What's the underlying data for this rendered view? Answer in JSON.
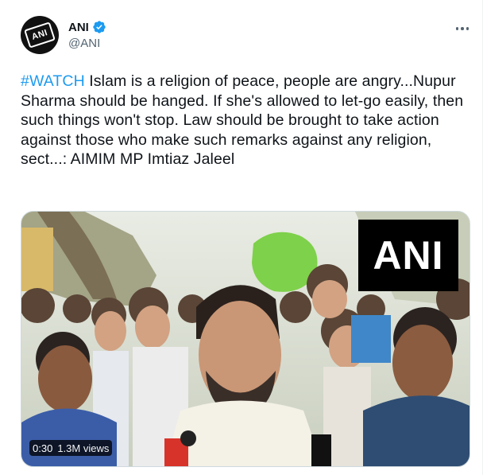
{
  "author": {
    "display_name": "ANI",
    "handle": "@ANI",
    "avatar_icon": "ani-logo-avatar",
    "avatar_text": "ANI",
    "verified_icon": "verified-badge-icon",
    "verified_color": "#1d9bf0"
  },
  "tweet": {
    "hashtag": "#WATCH",
    "text": " Islam is a religion of peace, people are angry...Nupur Sharma should be hanged. If she's allowed to let-go easily, then such things won't stop. Law should be brought to take action against those who make such remarks against any religion, sect...: AIMIM MP Imtiaz Jaleel",
    "hashtag_color": "#1d9bf0"
  },
  "media": {
    "type": "video",
    "watermark": "ANI",
    "duration": "0:30",
    "views": "1.3M views"
  },
  "menu": {
    "more_icon": "more-options-icon"
  }
}
